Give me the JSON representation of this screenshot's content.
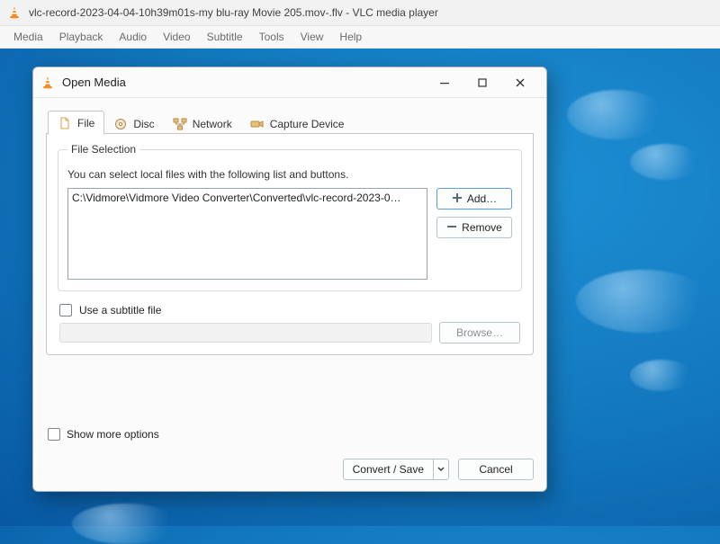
{
  "window": {
    "title": "vlc-record-2023-04-04-10h39m01s-my blu-ray Movie 205.mov-.flv - VLC media player"
  },
  "menubar": [
    "Media",
    "Playback",
    "Audio",
    "Video",
    "Subtitle",
    "Tools",
    "View",
    "Help"
  ],
  "dialog": {
    "title": "Open Media",
    "tabs": {
      "file": "File",
      "disc": "Disc",
      "network": "Network",
      "capture": "Capture Device"
    },
    "file_selection": {
      "legend": "File Selection",
      "hint": "You can select local files with the following list and buttons.",
      "files": [
        "C:\\Vidmore\\Vidmore Video Converter\\Converted\\vlc-record-2023-0…"
      ],
      "add_label": "Add…",
      "remove_label": "Remove"
    },
    "subtitle": {
      "use_label": "Use a subtitle file",
      "browse_label": "Browse…"
    },
    "show_more_label": "Show more options",
    "convert_label": "Convert / Save",
    "cancel_label": "Cancel"
  }
}
